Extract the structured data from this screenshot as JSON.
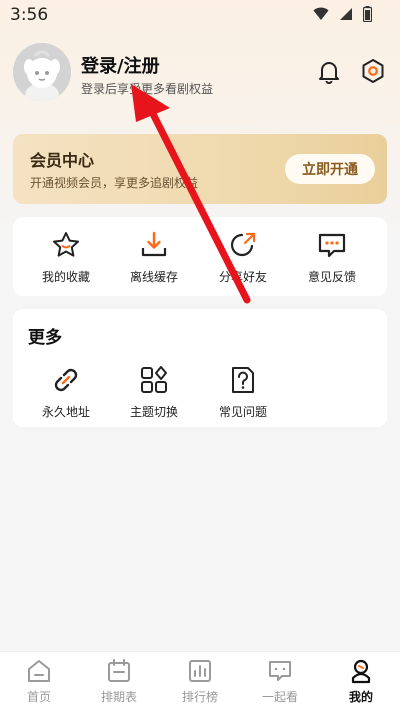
{
  "status_bar": {
    "time": "3:56"
  },
  "profile": {
    "title": "登录/注册",
    "subtitle": "登录后享受更多看剧权益"
  },
  "vip": {
    "title": "会员中心",
    "subtitle": "开通视频会员，享更多追剧权益",
    "button": "立即开通"
  },
  "quick_actions": [
    {
      "label": "我的收藏",
      "icon": "star-icon"
    },
    {
      "label": "离线缓存",
      "icon": "download-icon"
    },
    {
      "label": "分享好友",
      "icon": "share-icon"
    },
    {
      "label": "意见反馈",
      "icon": "feedback-icon"
    }
  ],
  "more": {
    "title": "更多",
    "items": [
      {
        "label": "永久地址",
        "icon": "link-icon"
      },
      {
        "label": "主题切换",
        "icon": "theme-icon"
      },
      {
        "label": "常见问题",
        "icon": "faq-icon"
      }
    ]
  },
  "tabbar": {
    "active": "我的",
    "items": [
      {
        "label": "首页",
        "icon": "home-icon"
      },
      {
        "label": "排期表",
        "icon": "calendar-icon"
      },
      {
        "label": "排行榜",
        "icon": "ranking-icon"
      },
      {
        "label": "一起看",
        "icon": "watch-together-icon"
      },
      {
        "label": "我的",
        "icon": "profile-icon"
      }
    ]
  },
  "colors": {
    "accent_orange": "#ff6a1a",
    "vip_gold": "#efd9ad",
    "annotation_red": "#e8141c"
  }
}
